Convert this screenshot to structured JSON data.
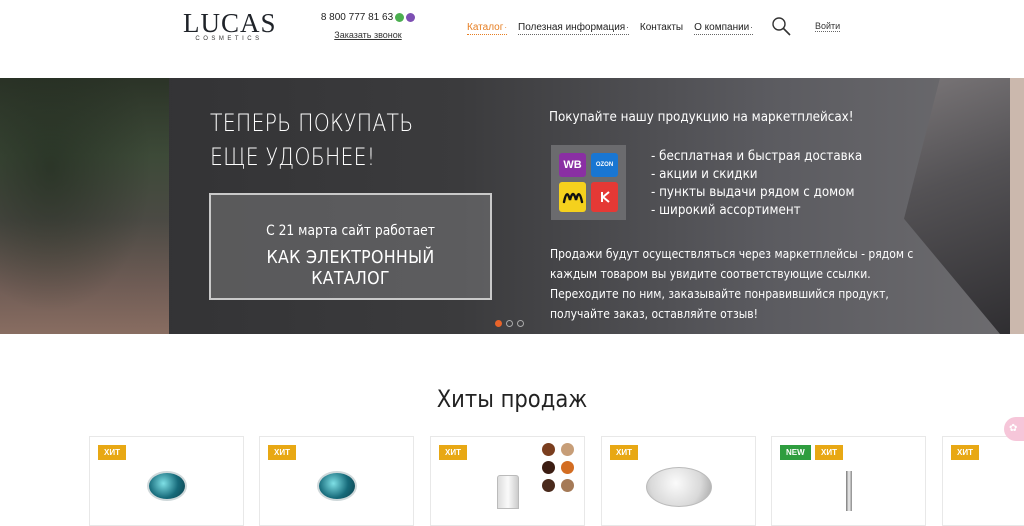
{
  "header": {
    "logo_main": "LUCAS",
    "logo_sub": "COSMETICS",
    "phone": "8 800 777 81 63",
    "callback": "Заказать звонок",
    "nav": [
      {
        "label": "Каталог",
        "active": true,
        "arrow": "·"
      },
      {
        "label": "Полезная информация",
        "active": false,
        "arrow": "·"
      },
      {
        "label": "Контакты",
        "active": false,
        "arrow": ""
      },
      {
        "label": "О компании",
        "active": false,
        "arrow": "·"
      }
    ],
    "login": "Войти"
  },
  "hero": {
    "title_line1": "ТЕПЕРЬ ПОКУПАТЬ",
    "title_line2": "ЕЩЕ УДОБНЕЕ!",
    "box_line1": "С 21 марта сайт работает",
    "box_line2": "КАК ЭЛЕКТРОННЫЙ КАТАЛОГ",
    "mp_heading": "Покупайте нашу продукцию на маркетплейсах!",
    "marketplaces": [
      {
        "name": "WB",
        "icon": "wildberries-icon"
      },
      {
        "name": "OZON",
        "icon": "ozon-icon"
      },
      {
        "name": "Я",
        "icon": "yandex-market-icon"
      },
      {
        "name": "К",
        "icon": "sbermegamarket-icon"
      }
    ],
    "features": [
      "- бесплатная и быстрая доставка",
      "- акции и скидки",
      "- пункты выдачи рядом с домом",
      "- широкий ассортимент"
    ],
    "description": "Продажи будут осуществляться через маркетплейсы - рядом с каждым товаром вы увидите соответствующие ссылки. Переходите по ним, заказывайте понравившийся продукт, получайте заказ, оставляйте отзыв!",
    "slides": 3,
    "active_slide": 1
  },
  "hits": {
    "title": "Хиты продаж",
    "badge_hit": "ХИТ",
    "badge_new": "NEW",
    "swatch_colors": [
      "#7a3e1f",
      "#c79e78",
      "#3b1d12",
      "#d36d22",
      "#4a2a1c",
      "#a57a57"
    ]
  },
  "colors": {
    "accent": "#e67e22",
    "hit_badge": "#e8a814",
    "new_badge": "#2e9d3f"
  }
}
